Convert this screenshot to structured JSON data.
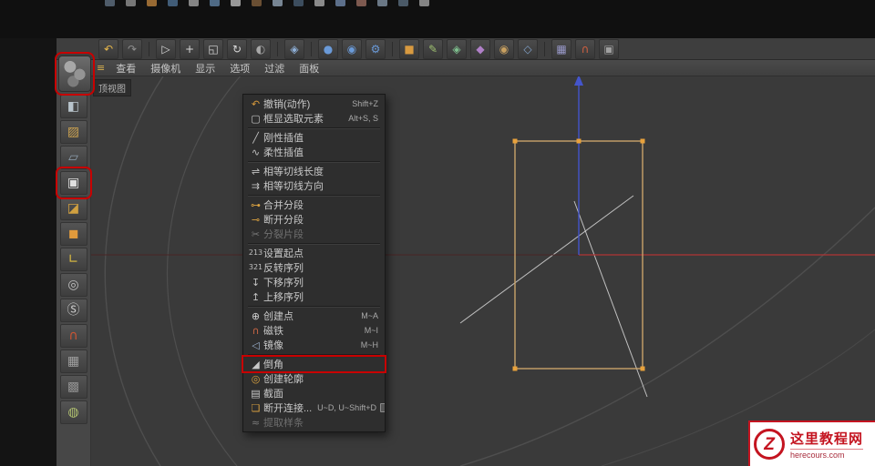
{
  "annotation_color": "#c80000",
  "titlebar": {
    "clipped_icon_colors": [
      "#5a6a7a",
      "#8a8a8a",
      "#b07a3a",
      "#4a6a8a",
      "#9a9a9a",
      "#5a7a9a",
      "#b0b0b0",
      "#7a5a3a",
      "#8a9aaa",
      "#44586c",
      "#a0a0a0",
      "#6a80a0",
      "#90665a",
      "#7a8a9a",
      "#556677",
      "#999999"
    ]
  },
  "top_toolbar": {
    "items": [
      {
        "name": "undo-icon",
        "glyph": "↶",
        "color": "#e8b84b"
      },
      {
        "name": "redo-icon",
        "glyph": "↷",
        "color": "#909090"
      },
      {
        "type": "separator"
      },
      {
        "name": "live-selection-icon",
        "glyph": "▷",
        "color": "#d8d8d8"
      },
      {
        "name": "move-tool-icon",
        "glyph": "+",
        "color": "#d8d8d8"
      },
      {
        "name": "scale-tool-icon",
        "glyph": "◱",
        "color": "#d8d8d8"
      },
      {
        "name": "rotate-tool-icon",
        "glyph": "↻",
        "color": "#d8d8d8"
      },
      {
        "name": "last-tool-icon",
        "glyph": "◐",
        "color": "#a8a8a8"
      },
      {
        "type": "separator"
      },
      {
        "name": "coordinate-system-icon",
        "glyph": "◈",
        "color": "#8fb0d8"
      },
      {
        "type": "separator"
      },
      {
        "name": "render-view-icon",
        "glyph": "●",
        "color": "#6a9ad8"
      },
      {
        "name": "render-picture-viewer-icon",
        "glyph": "◉",
        "color": "#6a9ad8"
      },
      {
        "name": "render-settings-icon",
        "glyph": "⚙",
        "color": "#6a9ad8"
      },
      {
        "type": "separator"
      },
      {
        "name": "primitive-cube-icon",
        "glyph": "■",
        "color": "#d89a40"
      },
      {
        "name": "spline-pen-icon",
        "glyph": "✎",
        "color": "#9ec070"
      },
      {
        "name": "mograph-icon",
        "glyph": "◈",
        "color": "#7fc08f"
      },
      {
        "name": "volume-icon",
        "glyph": "◆",
        "color": "#b080c8"
      },
      {
        "name": "simulate-icon",
        "glyph": "◉",
        "color": "#c8a060"
      },
      {
        "name": "deformer-icon",
        "glyph": "◇",
        "color": "#80a0c8"
      },
      {
        "type": "separator"
      },
      {
        "name": "workplane-icon",
        "glyph": "▦",
        "color": "#9898c8"
      },
      {
        "name": "snap-toggle-icon",
        "glyph": "∩",
        "color": "#d06040"
      },
      {
        "name": "lock-workplane-icon",
        "glyph": "▣",
        "color": "#a0a0a0"
      }
    ]
  },
  "left_toolbar": {
    "header_icon": {
      "name": "make-editable-icon",
      "boxed": true
    },
    "items": [
      {
        "name": "model-mode-icon",
        "glyph": "◧",
        "color": "#b8c4cc"
      },
      {
        "name": "texture-mode-icon",
        "glyph": "▨",
        "color": "#c8a050"
      },
      {
        "name": "workplane-mode-icon",
        "glyph": "▱",
        "color": "#8fa0b0"
      },
      {
        "name": "points-mode-icon",
        "glyph": "▣",
        "color": "#e0e0e0",
        "boxed": true
      },
      {
        "name": "edges-mode-icon",
        "glyph": "◪",
        "color": "#d0a040"
      },
      {
        "name": "polygons-mode-icon",
        "glyph": "◼",
        "color": "#e09a3c"
      },
      {
        "name": "enable-axis-icon",
        "glyph": "∟",
        "color": "#e0c040"
      },
      {
        "name": "viewport-solo-icon",
        "glyph": "◎",
        "color": "#c0c0c0"
      },
      {
        "name": "snap-icon",
        "glyph": "Ⓢ",
        "color": "#d0d0d0"
      },
      {
        "name": "magnet-icon",
        "glyph": "∩",
        "color": "#cc5533"
      },
      {
        "name": "workplane-lock-icon",
        "glyph": "▦",
        "color": "#a0a0a0"
      },
      {
        "name": "quantize-icon",
        "glyph": "▩",
        "color": "#909090"
      },
      {
        "name": "paint-icon",
        "glyph": "◍",
        "color": "#b0c070"
      }
    ]
  },
  "viewport": {
    "view_label": "顶视图",
    "grip_glyph": "≡",
    "menu_items": [
      {
        "name": "viewport-menu-view",
        "label": "查看"
      },
      {
        "name": "viewport-menu-camera",
        "label": "摄像机"
      },
      {
        "name": "viewport-menu-display",
        "label": "显示"
      },
      {
        "name": "viewport-menu-options",
        "label": "选项"
      },
      {
        "name": "viewport-menu-filter",
        "label": "过滤"
      },
      {
        "name": "viewport-menu-panel",
        "label": "面板"
      }
    ],
    "colors": {
      "background": "#3a3a3a",
      "grid_arc": "#4e4e4e",
      "spline": "#c9a36a",
      "point": "#e8a23c",
      "axis_y": "#4455cc",
      "axis_x": "#b03434",
      "guide": "#d8d8d8"
    }
  },
  "context_menu": {
    "items": [
      {
        "name": "menu-item-undo-action",
        "label": "撤销(动作)",
        "shortcut": "Shift+Z",
        "icon": "undo-icon",
        "glyph": "↶",
        "color": "#d89a3c"
      },
      {
        "name": "menu-item-frame-selected",
        "label": "框显选取元素",
        "shortcut": "Alt+S, S",
        "icon": "frame-selected-icon",
        "glyph": "▢",
        "color": "#c0c0c0"
      },
      {
        "type": "separator"
      },
      {
        "name": "menu-item-hard-interpolation",
        "label": "刚性插值",
        "icon": "hard-interpolation-icon",
        "glyph": "╱",
        "color": "#c0c0c0"
      },
      {
        "name": "menu-item-soft-interpolation",
        "label": "柔性插值",
        "icon": "soft-interpolation-icon",
        "glyph": "∿",
        "color": "#c0c0c0"
      },
      {
        "type": "separator"
      },
      {
        "name": "menu-item-equal-tangent-length",
        "label": "相等切线长度",
        "icon": "equal-tangent-length-icon",
        "glyph": "⇌",
        "color": "#c0c0c0"
      },
      {
        "name": "menu-item-equal-tangent-direction",
        "label": "相等切线方向",
        "icon": "equal-tangent-direction-icon",
        "glyph": "⇉",
        "color": "#c0c0c0"
      },
      {
        "type": "separator"
      },
      {
        "name": "menu-item-join-segment",
        "label": "合并分段",
        "icon": "join-segment-icon",
        "glyph": "⊶",
        "color": "#d8a040"
      },
      {
        "name": "menu-item-break-segment",
        "label": "断开分段",
        "icon": "break-segment-icon",
        "glyph": "⊸",
        "color": "#d8a040"
      },
      {
        "name": "menu-item-explode-segments",
        "label": "分裂片段",
        "icon": "explode-segments-icon",
        "glyph": "✂",
        "color": "#7a7a7a",
        "disabled": true
      },
      {
        "type": "separator"
      },
      {
        "name": "menu-item-set-first-point",
        "label": "设置起点",
        "icon": "set-first-point-icon",
        "glyph": "213",
        "color": "#c0c0c0"
      },
      {
        "name": "menu-item-reverse-sequence",
        "label": "反转序列",
        "icon": "reverse-sequence-icon",
        "glyph": "321",
        "color": "#c0c0c0"
      },
      {
        "name": "menu-item-move-down-sequence",
        "label": "下移序列",
        "icon": "move-down-sequence-icon",
        "glyph": "↧",
        "color": "#c0c0c0"
      },
      {
        "name": "menu-item-move-up-sequence",
        "label": "上移序列",
        "icon": "move-up-sequence-icon",
        "glyph": "↥",
        "color": "#c0c0c0"
      },
      {
        "type": "separator"
      },
      {
        "name": "menu-item-create-point",
        "label": "创建点",
        "shortcut": "M~A",
        "icon": "create-point-icon",
        "glyph": "⊕",
        "color": "#d0d0d0"
      },
      {
        "name": "menu-item-magnet",
        "label": "磁铁",
        "shortcut": "M~I",
        "icon": "magnet-icon",
        "glyph": "∩",
        "color": "#cc6644"
      },
      {
        "name": "menu-item-mirror",
        "label": "镜像",
        "shortcut": "M~H",
        "icon": "mirror-icon",
        "glyph": "◁",
        "color": "#9ab0cc"
      },
      {
        "type": "separator"
      },
      {
        "name": "menu-item-bevel",
        "label": "倒角",
        "icon": "bevel-icon",
        "glyph": "◢",
        "color": "#c8c8c8",
        "highlighted": true
      },
      {
        "name": "menu-item-create-outline",
        "label": "创建轮廓",
        "icon": "create-outline-icon",
        "glyph": "◎",
        "color": "#d8a040"
      },
      {
        "name": "menu-item-cross-section",
        "label": "截面",
        "icon": "cross-section-icon",
        "glyph": "▤",
        "color": "#c8c8c8"
      },
      {
        "name": "menu-item-disconnect",
        "label": "断开连接...",
        "shortcut": "U~D, U~Shift+D",
        "icon": "disconnect-icon",
        "glyph": "❏",
        "color": "#d8a040",
        "options": true
      },
      {
        "name": "menu-item-extract-spline",
        "label": "提取样条",
        "icon": "extract-spline-icon",
        "glyph": "≈",
        "color": "#7a7a7a",
        "disabled": true
      }
    ]
  },
  "watermark": {
    "site_name": "这里教程网",
    "site_url": "herecours.com",
    "logo_letter": "Z",
    "color": "#c41420"
  }
}
